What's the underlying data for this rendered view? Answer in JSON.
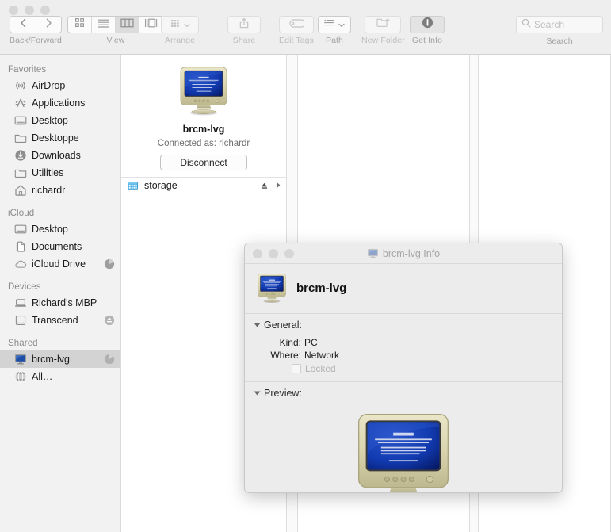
{
  "finder": {
    "toolbar": {
      "back_forward_caption": "Back/Forward",
      "back_icon": "chevron-left-icon",
      "forward_icon": "chevron-right-icon",
      "view_caption": "View",
      "view_modes": [
        {
          "name": "icon-view",
          "icon": "grid-icon",
          "selected": false
        },
        {
          "name": "list-view",
          "icon": "lines-icon",
          "selected": false
        },
        {
          "name": "column-view",
          "icon": "columns-icon",
          "selected": true
        },
        {
          "name": "gallery-view",
          "icon": "gallery-icon",
          "selected": false
        }
      ],
      "arrange_caption": "Arrange",
      "arrange_icon": "arrange-grid-icon",
      "share_caption": "Share",
      "share_icon": "share-up-arrow-icon",
      "edit_tags_caption": "Edit Tags",
      "edit_tags_icon": "tag-icon",
      "path_caption": "Path",
      "path_icon": "path-list-icon",
      "new_folder_caption": "New Folder",
      "new_folder_icon": "folder-plus-icon",
      "get_info_caption": "Get Info",
      "get_info_icon": "info-circle-icon",
      "search_caption": "Search",
      "search_placeholder": "Search",
      "search_value": "",
      "search_icon": "magnifier-icon"
    },
    "sidebar": {
      "sections": [
        {
          "header": "Favorites",
          "items": [
            {
              "label": "AirDrop",
              "icon": "airdrop-icon",
              "selected": false,
              "badge": ""
            },
            {
              "label": "Applications",
              "icon": "applications-icon",
              "selected": false,
              "badge": ""
            },
            {
              "label": "Desktop",
              "icon": "desktop-icon",
              "selected": false,
              "badge": ""
            },
            {
              "label": "Desktoppe",
              "icon": "folder-icon",
              "selected": false,
              "badge": ""
            },
            {
              "label": "Downloads",
              "icon": "downloads-icon",
              "selected": false,
              "badge": ""
            },
            {
              "label": "Utilities",
              "icon": "folder-icon",
              "selected": false,
              "badge": ""
            },
            {
              "label": "richardr",
              "icon": "home-icon",
              "selected": false,
              "badge": ""
            }
          ]
        },
        {
          "header": "iCloud",
          "items": [
            {
              "label": "Desktop",
              "icon": "desktop-icon",
              "selected": false,
              "badge": ""
            },
            {
              "label": "Documents",
              "icon": "documents-icon",
              "selected": false,
              "badge": ""
            },
            {
              "label": "iCloud Drive",
              "icon": "cloud-icon",
              "selected": false,
              "badge": "progress-pie-icon"
            }
          ]
        },
        {
          "header": "Devices",
          "items": [
            {
              "label": "Richard's MBP",
              "icon": "laptop-icon",
              "selected": false,
              "badge": ""
            },
            {
              "label": "Transcend",
              "icon": "harddisk-icon",
              "selected": false,
              "badge": "eject-icon"
            }
          ]
        },
        {
          "header": "Shared",
          "items": [
            {
              "label": "brcm-lvg",
              "icon": "monitor-icon",
              "selected": true,
              "badge": "progress-pie-icon"
            },
            {
              "label": "All…",
              "icon": "globe-icon",
              "selected": false,
              "badge": ""
            }
          ]
        }
      ]
    },
    "column_view": {
      "server_preview": {
        "icon": "crt-monitor-pc-icon",
        "name": "brcm-lvg",
        "connected_as": "Connected as: richardr",
        "disconnect_label": "Disconnect"
      },
      "rows": [
        {
          "label": "storage",
          "icon": "network-share-icon",
          "eject_icon": "eject-icon",
          "chevron_icon": "chevron-right-icon"
        }
      ]
    }
  },
  "info_window": {
    "title": "brcm-lvg Info",
    "title_icon": "monitor-icon",
    "item_icon": "crt-monitor-pc-icon",
    "item_name": "brcm-lvg",
    "general": {
      "section_label": "General:",
      "fields": [
        {
          "key": "Kind:",
          "value": "PC"
        },
        {
          "key": "Where:",
          "value": "Network"
        }
      ],
      "locked_label": "Locked",
      "locked_checked": false
    },
    "preview": {
      "section_label": "Preview:",
      "icon": "crt-monitor-pc-icon"
    }
  },
  "colors": {
    "toolbar_bg": "#eeeeee",
    "sidebar_bg": "#f2f2f2",
    "selection_bg": "#d3d3d3",
    "info_bg": "#ececec",
    "crt_screen_blue": "#0a249c",
    "crt_bezel": "#d8d3b0",
    "share_volume_blue": "#46b0e8"
  }
}
